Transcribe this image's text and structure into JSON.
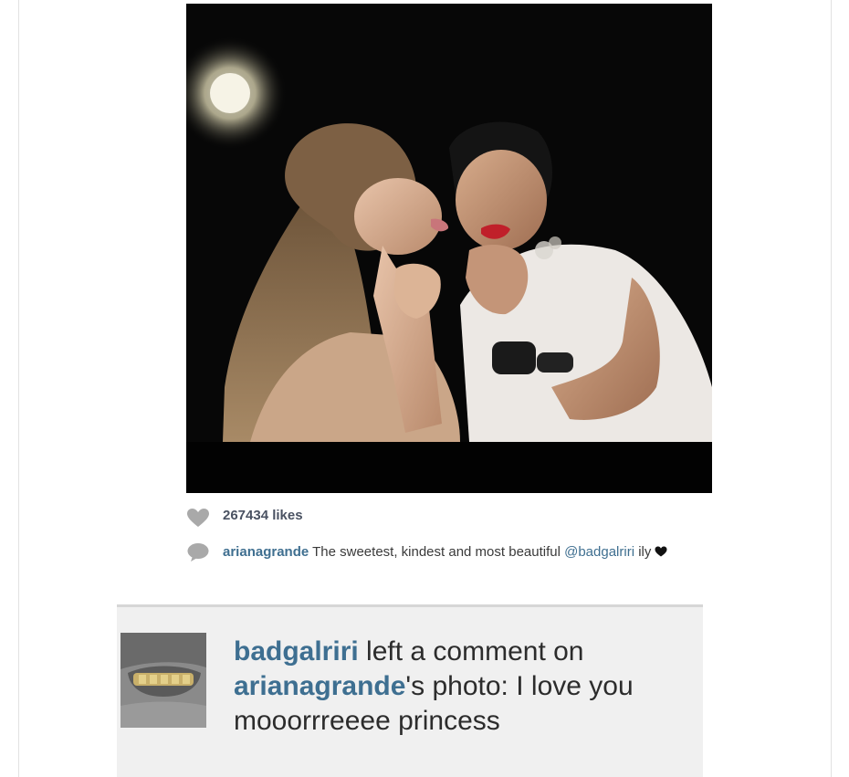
{
  "post": {
    "likes_text": "267434 likes",
    "caption": {
      "username": "arianagrande",
      "text": " The sweetest, kindest and most beautiful ",
      "mention": "@badgalriri",
      "suffix": " ily"
    }
  },
  "notification": {
    "username": "badgalriri",
    "action_text": " left a comment on ",
    "photo_owner": "arianagrande",
    "photo_suffix": "'s photo: ",
    "comment": "I love you mooorrreeee princess"
  },
  "icons": {
    "likes": "heart-icon",
    "caption": "comment-bubble-icon",
    "caption_emoji": "black-heart-icon"
  },
  "colors": {
    "username_blue": "#3e6f91",
    "photo_background": "#070707",
    "card_background": "#f0f0f0"
  }
}
